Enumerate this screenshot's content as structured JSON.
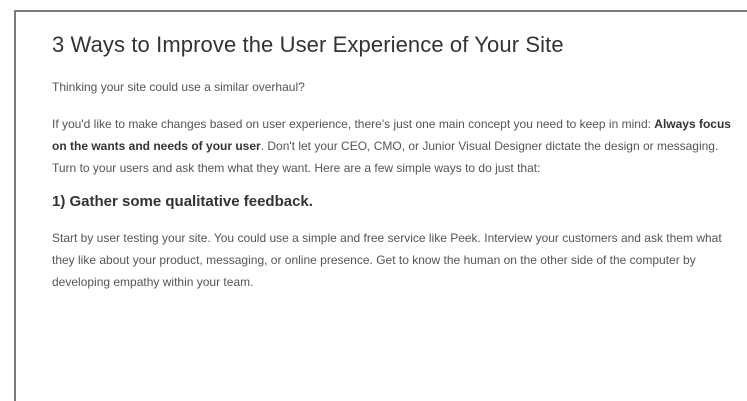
{
  "article": {
    "title": "3 Ways to Improve the User Experience of Your Site",
    "intro": "Thinking your site could use a similar overhaul?",
    "paragraph1": {
      "before": "If you'd like to make changes based on user experience, there's just one main concept you need to keep in mind: ",
      "emphasis": "Always focus on the wants and needs of your user",
      "after": ". Don't let your CEO, CMO, or Junior Visual Designer dictate the design or messaging. Turn to your users and ask them what they want. Here are a few simple ways to do just that:"
    },
    "section1": {
      "heading": "1) Gather some qualitative feedback.",
      "body": "Start by user testing your site. You could use a simple and free service like Peek. Interview your customers and ask them what they like about your product, messaging, or online presence. Get to know the human on the other side of the computer by developing empathy within your team."
    }
  }
}
